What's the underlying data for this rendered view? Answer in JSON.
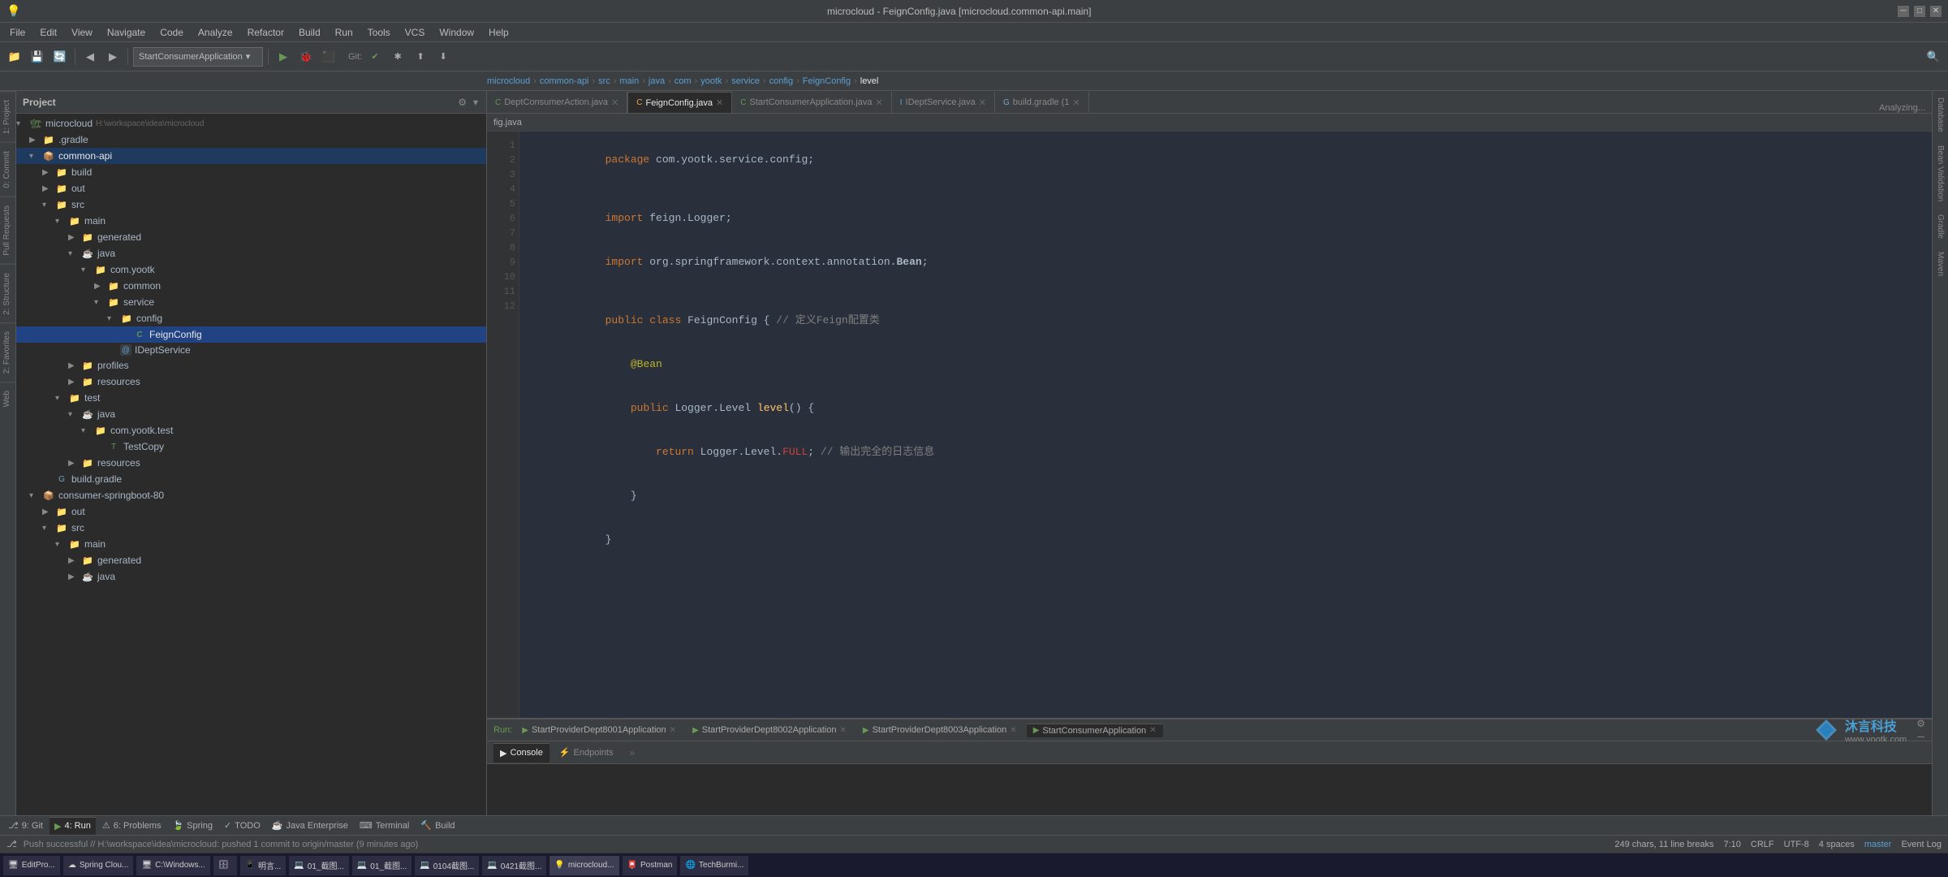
{
  "titleBar": {
    "title": "microcloud - FeignConfig.java [microcloud.common-api.main]",
    "controls": [
      "minimize",
      "maximize",
      "close"
    ]
  },
  "menuBar": {
    "items": [
      "File",
      "Edit",
      "View",
      "Navigate",
      "Code",
      "Analyze",
      "Refactor",
      "Build",
      "Run",
      "Tools",
      "VCS",
      "Window",
      "Help"
    ]
  },
  "toolbar": {
    "dropdown": "StartConsumerApplication",
    "git_label": "Git:"
  },
  "breadcrumbs": {
    "items": [
      "microcloud",
      "common-api",
      "src",
      "main",
      "java",
      "com",
      "yootk",
      "service",
      "config",
      "FeignConfig",
      "level"
    ]
  },
  "project_panel": {
    "title": "Project",
    "tree": [
      {
        "id": "microcloud",
        "label": "microcloud",
        "indent": 0,
        "type": "project",
        "expanded": true,
        "path": "H:\\workspace\\idea\\microcloud"
      },
      {
        "id": "gradle",
        "label": ".gradle",
        "indent": 1,
        "type": "folder",
        "expanded": false
      },
      {
        "id": "common-api",
        "label": "common-api",
        "indent": 1,
        "type": "module",
        "expanded": true
      },
      {
        "id": "build",
        "label": "build",
        "indent": 2,
        "type": "folder",
        "expanded": false
      },
      {
        "id": "out",
        "label": "out",
        "indent": 2,
        "type": "folder",
        "expanded": false
      },
      {
        "id": "src",
        "label": "src",
        "indent": 2,
        "type": "folder",
        "expanded": true
      },
      {
        "id": "main",
        "label": "main",
        "indent": 3,
        "type": "folder",
        "expanded": true
      },
      {
        "id": "generated",
        "label": "generated",
        "indent": 4,
        "type": "folder",
        "expanded": false
      },
      {
        "id": "java",
        "label": "java",
        "indent": 4,
        "type": "folder-blue",
        "expanded": true
      },
      {
        "id": "com.yootk",
        "label": "com.yootk",
        "indent": 5,
        "type": "folder",
        "expanded": true
      },
      {
        "id": "common",
        "label": "common",
        "indent": 6,
        "type": "folder",
        "expanded": false
      },
      {
        "id": "service",
        "label": "service",
        "indent": 6,
        "type": "folder",
        "expanded": true
      },
      {
        "id": "config",
        "label": "config",
        "indent": 7,
        "type": "folder",
        "expanded": true
      },
      {
        "id": "FeignConfig",
        "label": "FeignConfig",
        "indent": 8,
        "type": "java",
        "selected": true
      },
      {
        "id": "IDeptService",
        "label": "IDeptService",
        "indent": 7,
        "type": "java-interface"
      },
      {
        "id": "profiles",
        "label": "profiles",
        "indent": 4,
        "type": "folder",
        "expanded": false
      },
      {
        "id": "resources",
        "label": "resources",
        "indent": 4,
        "type": "folder",
        "expanded": false
      },
      {
        "id": "test",
        "label": "test",
        "indent": 3,
        "type": "folder",
        "expanded": true
      },
      {
        "id": "java-test",
        "label": "java",
        "indent": 4,
        "type": "folder",
        "expanded": true
      },
      {
        "id": "com.yootk.test",
        "label": "com.yootk.test",
        "indent": 5,
        "type": "folder",
        "expanded": true
      },
      {
        "id": "TestCopy",
        "label": "TestCopy",
        "indent": 6,
        "type": "java"
      },
      {
        "id": "resources-test",
        "label": "resources",
        "indent": 4,
        "type": "folder",
        "expanded": false
      },
      {
        "id": "build-gradle",
        "label": "build.gradle",
        "indent": 2,
        "type": "gradle"
      },
      {
        "id": "consumer-springboot-80",
        "label": "consumer-springboot-80",
        "indent": 1,
        "type": "module",
        "expanded": true
      },
      {
        "id": "out2",
        "label": "out",
        "indent": 2,
        "type": "folder",
        "expanded": false
      },
      {
        "id": "src2",
        "label": "src",
        "indent": 2,
        "type": "folder",
        "expanded": true
      },
      {
        "id": "main2",
        "label": "main",
        "indent": 3,
        "type": "folder",
        "expanded": true
      },
      {
        "id": "generated2",
        "label": "generated",
        "indent": 4,
        "type": "folder",
        "expanded": false
      },
      {
        "id": "java2",
        "label": "java",
        "indent": 4,
        "type": "folder",
        "expanded": false
      }
    ]
  },
  "editor": {
    "tabs": [
      {
        "label": "DeptConsumerAction.java",
        "type": "java",
        "active": false
      },
      {
        "label": "FeignConfig.java",
        "type": "feign",
        "active": true
      },
      {
        "label": "StartConsumerApplication.java",
        "type": "java",
        "active": false
      },
      {
        "label": "IDeptService.java",
        "type": "java-interface",
        "active": false
      },
      {
        "label": "build.gradle (1",
        "type": "gradle",
        "active": false
      }
    ],
    "breadcrumb": "fig.java",
    "code_lines": [
      {
        "num": 1,
        "content": "package com.yootk.service.config;"
      },
      {
        "num": 2,
        "content": ""
      },
      {
        "num": 3,
        "content": "import feign.Logger;"
      },
      {
        "num": 4,
        "content": "import org.springframework.context.annotation.Bean;"
      },
      {
        "num": 5,
        "content": ""
      },
      {
        "num": 6,
        "content": "public class FeignConfig { // 定义Feign配置类"
      },
      {
        "num": 7,
        "content": "    @Bean"
      },
      {
        "num": 8,
        "content": "    public Logger.Level level() {"
      },
      {
        "num": 9,
        "content": "        return Logger.Level.FULL; // 输出完全的日志信息"
      },
      {
        "num": 10,
        "content": "    }"
      },
      {
        "num": 11,
        "content": "}"
      },
      {
        "num": 12,
        "content": ""
      }
    ]
  },
  "run_panel": {
    "label": "Run:",
    "tabs": [
      {
        "label": "StartProviderDept8001Application"
      },
      {
        "label": "StartProviderDept8002Application"
      },
      {
        "label": "StartProviderDept8003Application"
      },
      {
        "label": "StartConsumerApplication",
        "active": true
      }
    ],
    "bottom_tabs": [
      {
        "label": "Console",
        "active": true
      },
      {
        "label": "Endpoints"
      }
    ]
  },
  "right_panels": [
    "Database",
    "Bean Validation",
    "Gradle",
    "Maven"
  ],
  "left_vert_tabs": [
    "1: Project",
    "0: Commit",
    "Pull Requests",
    "2: Structure",
    "2: Favorites",
    "Web"
  ],
  "status_bar": {
    "git": "9: Git",
    "run": "4: Run",
    "problems": "6: Problems",
    "spring": "Spring",
    "todo": "TODO",
    "java_enterprise": "Java Enterprise",
    "terminal": "Terminal",
    "build": "Build",
    "stats": "249 chars, 11 line breaks",
    "position": "7:10",
    "line_ending": "CRLF",
    "encoding": "UTF-8",
    "indent": "4 spaces",
    "branch": "master",
    "message": "Push successful // H:\\workspace\\idea\\microcloud: pushed 1 commit to origin/master (9 minutes ago)",
    "event_log": "Event Log"
  },
  "analyzing": "Analyzing...",
  "logo": {
    "name": "沐言科技",
    "url": "www.yootk.com"
  }
}
